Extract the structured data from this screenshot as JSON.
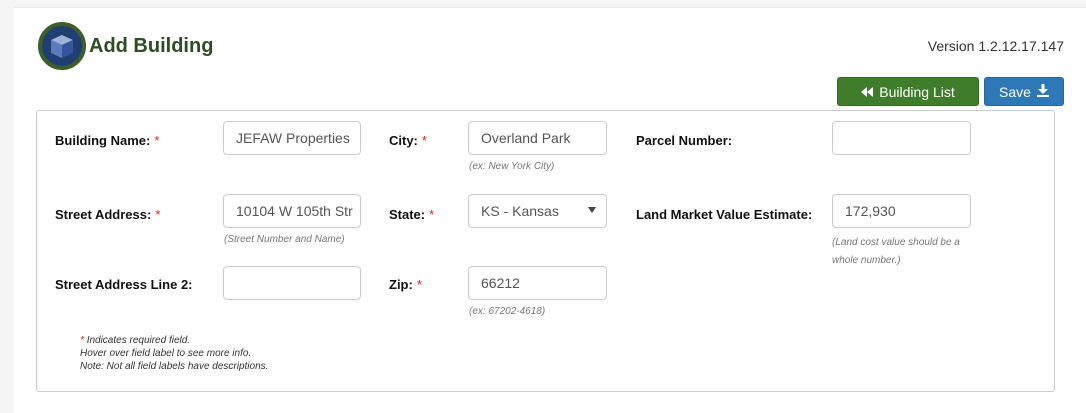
{
  "header": {
    "title": "Add Building",
    "version": "Version 1.2.12.17.147"
  },
  "toolbar": {
    "building_list_label": "Building List",
    "save_label": "Save"
  },
  "form": {
    "building_name": {
      "label": "Building Name:",
      "value": "JEFAW Properties"
    },
    "street_address": {
      "label": "Street Address:",
      "value": "10104 W 105th Str",
      "help": "(Street Number and Name)"
    },
    "street_address_2": {
      "label": "Street Address Line 2:",
      "value": ""
    },
    "city": {
      "label": "City:",
      "value": "Overland Park",
      "help": "(ex: New York City)"
    },
    "state": {
      "label": "State:",
      "value": "KS - Kansas"
    },
    "zip": {
      "label": "Zip:",
      "value": "66212",
      "help": "(ex: 67202-4618)"
    },
    "parcel_number": {
      "label": "Parcel Number:",
      "value": ""
    },
    "land_value": {
      "label": "Land Market Value Estimate:",
      "value": "172,930",
      "help_line1": "(Land cost value should be a",
      "help_line2": "whole number.)"
    }
  },
  "notes": {
    "required_star": "*",
    "required_text": "Indicates required field.",
    "hover_text": "Hover over field label to see more info.",
    "note_text": "Note: Not all field labels have descriptions."
  },
  "required_marker": "*",
  "colors": {
    "title_green": "#2d4d22",
    "green_button": "#3f7d2a",
    "blue_button": "#2f78b8",
    "required_red": "#dd2211",
    "logo_blue": "#1f3f73"
  },
  "icons": [
    "building-logo-icon",
    "double-chevron-left-icon",
    "download-icon",
    "caret-down-icon"
  ]
}
